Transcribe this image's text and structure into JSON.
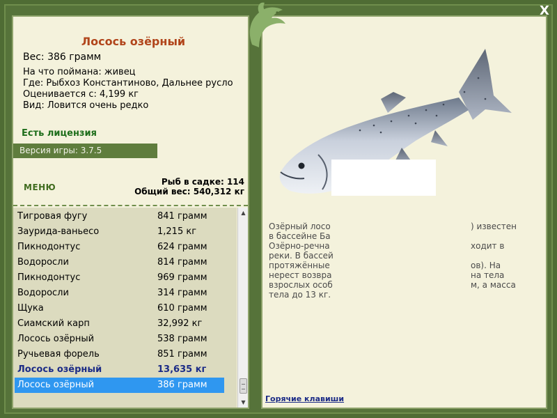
{
  "fish": {
    "title": "Лосось озёрный",
    "weight": "Вес: 386 грамм",
    "caught_on": "На что поймана: живец",
    "where": "Где: Рыбхоз Константиново, Дальнее русло",
    "valued": "Оценивается с: 4,199 кг",
    "kind": "Вид: Ловится очень редко",
    "license": "Есть лицензия"
  },
  "version": "Версия игры: 3.7.5",
  "menu_label": "МЕНЮ",
  "stats": {
    "fish_in_keepnet": "Рыб в садке: 114",
    "total_weight": "Общий вес: 540,312 кг"
  },
  "catch_list": [
    {
      "name": "Тигровая фугу",
      "weight": "841 грамм"
    },
    {
      "name": "Заурида-ваньесо",
      "weight": "1,215 кг"
    },
    {
      "name": "Пикнодонтус",
      "weight": "624 грамм"
    },
    {
      "name": "Водоросли",
      "weight": "814 грамм"
    },
    {
      "name": "Пикнодонтус",
      "weight": "969 грамм"
    },
    {
      "name": "Водоросли",
      "weight": "314 грамм"
    },
    {
      "name": "Щука",
      "weight": "610 грамм"
    },
    {
      "name": "Сиамский карп",
      "weight": "32,992 кг"
    },
    {
      "name": "Лосось озёрный",
      "weight": "538 грамм"
    },
    {
      "name": "Ручьевая форель",
      "weight": "851 грамм"
    },
    {
      "name": "Лосось озёрный",
      "weight": "13,635 кг"
    },
    {
      "name": "Лосось озёрный",
      "weight": "386 грамм"
    }
  ],
  "description": {
    "lines_left": [
      "Озёрный лосо",
      "в бассейне Ба",
      "Озёрно-речна",
      "реки. В бассей",
      "протяжённые",
      "нерест возвра",
      "взрослых особ",
      "тела до 13 кг."
    ],
    "lines_right": [
      ") известен",
      "",
      "ходит в",
      "",
      "ов). На",
      "на тела",
      "м, а масса",
      ""
    ]
  },
  "hotkeys_label": "Горячие клавиши",
  "close_label": "X",
  "colors": {
    "frame": "#4f6c34",
    "panel": "#f4f2dc",
    "title": "#b1451b",
    "license": "#1e6e1b",
    "highlight": "#2f97f0",
    "bold_row": "#1b2b86"
  },
  "icons": {
    "close": "close-icon",
    "logo": "fish-logo-icon"
  }
}
